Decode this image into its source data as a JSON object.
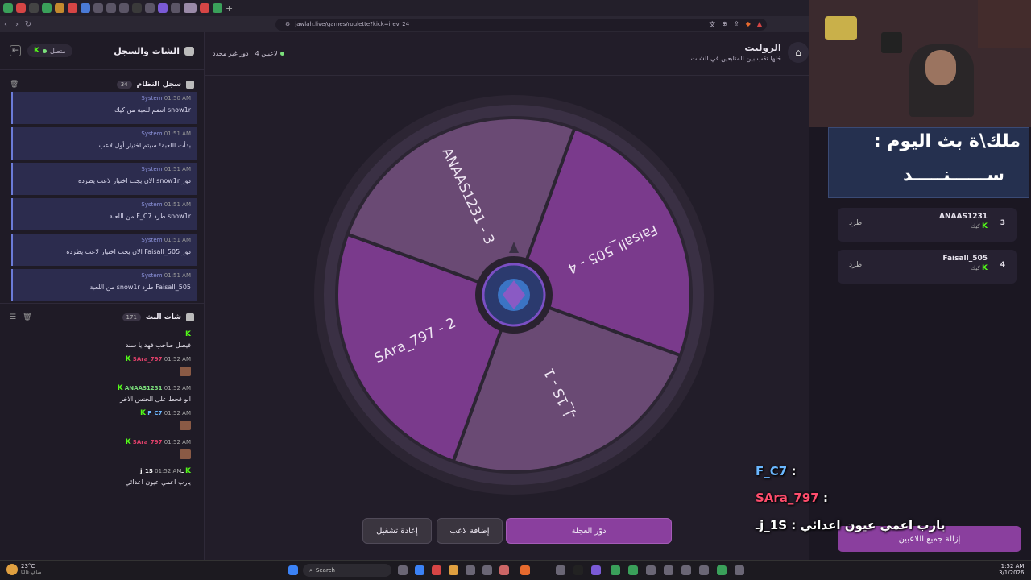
{
  "browser": {
    "url": "jawlah.live/games/roulette?kick=irev_24",
    "tab_label": ""
  },
  "left": {
    "chat_log_title": "الشات والسجل",
    "connection_status": "متصل",
    "system_log_title": "سجل النظام",
    "system_log_count": "34",
    "system_messages": [
      {
        "sender": "System",
        "time": "01:50 AM",
        "text": "snow1r انضم للعبة من كيك"
      },
      {
        "sender": "System",
        "time": "01:51 AM",
        "text": "بدأت اللعبة! سيتم اختيار أول لاعب"
      },
      {
        "sender": "System",
        "time": "01:51 AM",
        "text": "دور snow1r الان يجب اختيار لاعب يطرده"
      },
      {
        "sender": "System",
        "time": "01:51 AM",
        "text": "snow1r طرد F_C7 من اللعبة"
      },
      {
        "sender": "System",
        "time": "01:51 AM",
        "text": "دور Faisall_505 الان يجب اختيار لاعب يطرده"
      },
      {
        "sender": "System",
        "time": "01:51 AM",
        "text": "Faisall_505 طرد snow1r من اللعبة"
      }
    ],
    "stream_chat_title": "شات البث",
    "stream_chat_count": "171",
    "chat_messages": [
      {
        "user": "",
        "time": "",
        "text": "فيصل صاحب فهد يا سند",
        "color": "#e0406a",
        "emote": false
      },
      {
        "user": "SAra_797",
        "time": "01:52 AM",
        "text": "",
        "color": "#e0406a",
        "emote": true
      },
      {
        "user": "ANAAS1231",
        "time": "01:52 AM",
        "text": "ابو قحط على الجنس الاخر",
        "color": "#7be07b",
        "emote": false
      },
      {
        "user": "F_C7",
        "time": "01:52 AM",
        "text": "",
        "color": "#6bb7ff",
        "emote": true
      },
      {
        "user": "SAra_797",
        "time": "01:52 AM",
        "text": "",
        "color": "#e0406a",
        "emote": true
      },
      {
        "user": "ـj_1S",
        "time": "01:52 AM",
        "text": "يارب اعمي عيون اعدائي",
        "color": "#ffffff",
        "emote": false
      }
    ]
  },
  "main": {
    "title": "الروليت",
    "subtitle": "خلها تقب بين المتابعين في الشات",
    "players_count": "4 لاعبين",
    "turn_status": "دور غير محدد",
    "wheel": {
      "segments": [
        {
          "label": "Faisall_505 - 4",
          "color": "#7a3a8c"
        },
        {
          "label": "ـj_1S - 1",
          "color": "#6a4a74"
        },
        {
          "label": "SAra_797 - 2",
          "color": "#7a3a8c"
        },
        {
          "label": "ANAAS1231 - 3",
          "color": "#6a4a74"
        }
      ]
    },
    "buttons": {
      "spin": "دوّر العجلة",
      "add_player": "إضافة لاعب",
      "restart": "إعادة تشغيل"
    }
  },
  "right": {
    "banner_line1": "ملك\\ة بث اليوم :",
    "banner_line2": "ســــــنـــــد",
    "queue": [
      {
        "num": "3",
        "name": "ANAAS1231",
        "platform": "كيك",
        "action": "طرد"
      },
      {
        "num": "4",
        "name": "Faisall_505",
        "platform": "كيك",
        "action": "طرد"
      }
    ],
    "remove_all": "إزالة جميع اللاعبين",
    "overlay_chat": [
      {
        "user": "F_C7",
        "text": ":",
        "color": "#6bb7ff"
      },
      {
        "user": "SAra_797",
        "text": ":",
        "color": "#ff4d6d"
      },
      {
        "user": "ـj_1S",
        "text": ": يارب اعمي عيون اعدائي",
        "color": "#ffffff"
      }
    ]
  },
  "taskbar": {
    "weather": "23°C",
    "weather_sub": "صافٍ غالبًا",
    "search": "Search",
    "time": "1:52 AM",
    "date": "3/1/2026"
  }
}
